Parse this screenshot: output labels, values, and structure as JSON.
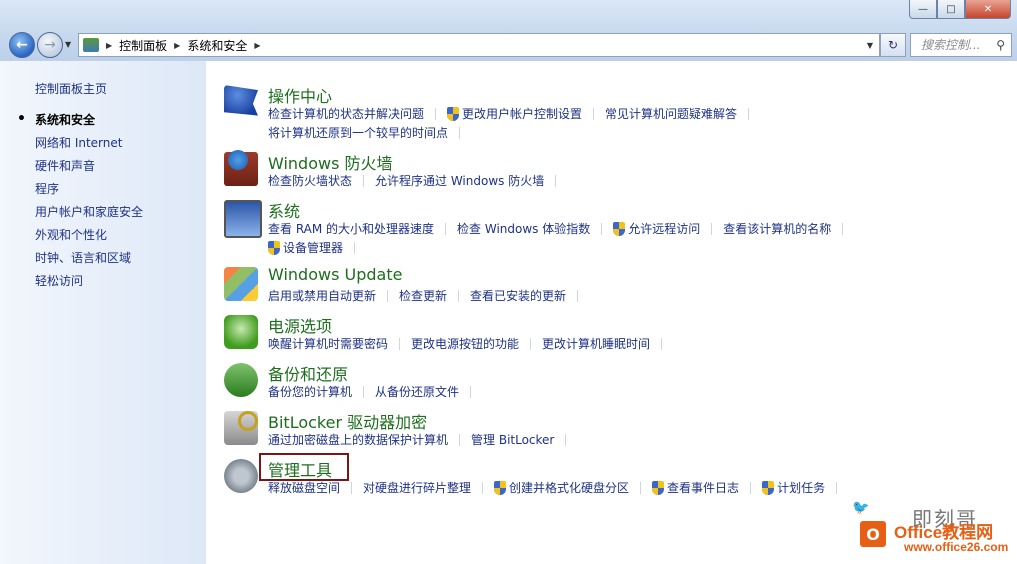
{
  "window": {
    "minimize_glyph": "—",
    "maximize_glyph": "□",
    "close_glyph": "✕"
  },
  "nav": {
    "back_glyph": "←",
    "forward_glyph": "→"
  },
  "address": {
    "crumbs": [
      "控制面板",
      "系统和安全"
    ]
  },
  "search": {
    "placeholder": "搜索控制..."
  },
  "sidebar": {
    "home": "控制面板主页",
    "items": [
      {
        "label": "系统和安全",
        "current": true
      },
      {
        "label": "网络和 Internet"
      },
      {
        "label": "硬件和声音"
      },
      {
        "label": "程序"
      },
      {
        "label": "用户帐户和家庭安全"
      },
      {
        "label": "外观和个性化"
      },
      {
        "label": "时钟、语言和区域"
      },
      {
        "label": "轻松访问"
      }
    ]
  },
  "categories": [
    {
      "title": "操作中心",
      "icon": "action-center-flag-icon",
      "rows": [
        [
          {
            "label": "检查计算机的状态并解决问题"
          },
          {
            "label": "更改用户帐户控制设置",
            "shield": true
          },
          {
            "label": "常见计算机问题疑难解答"
          }
        ],
        [
          {
            "label": "将计算机还原到一个较早的时间点"
          }
        ]
      ]
    },
    {
      "title": "Windows 防火墙",
      "icon": "firewall-icon",
      "rows": [
        [
          {
            "label": "检查防火墙状态"
          },
          {
            "label": "允许程序通过 Windows 防火墙"
          }
        ]
      ]
    },
    {
      "title": "系统",
      "icon": "system-computer-icon",
      "rows": [
        [
          {
            "label": "查看 RAM 的大小和处理器速度"
          },
          {
            "label": "检查 Windows 体验指数"
          },
          {
            "label": "允许远程访问",
            "shield": true
          },
          {
            "label": "查看该计算机的名称"
          }
        ],
        [
          {
            "label": "设备管理器",
            "shield": true
          }
        ]
      ]
    },
    {
      "title": "Windows Update",
      "icon": "windows-update-icon",
      "rows": [
        [
          {
            "label": "启用或禁用自动更新"
          },
          {
            "label": "检查更新"
          },
          {
            "label": "查看已安装的更新"
          }
        ]
      ]
    },
    {
      "title": "电源选项",
      "icon": "power-options-icon",
      "rows": [
        [
          {
            "label": "唤醒计算机时需要密码"
          },
          {
            "label": "更改电源按钮的功能"
          },
          {
            "label": "更改计算机睡眠时间"
          }
        ]
      ]
    },
    {
      "title": "备份和还原",
      "icon": "backup-restore-icon",
      "rows": [
        [
          {
            "label": "备份您的计算机"
          },
          {
            "label": "从备份还原文件"
          }
        ]
      ]
    },
    {
      "title": "BitLocker 驱动器加密",
      "icon": "bitlocker-icon",
      "rows": [
        [
          {
            "label": "通过加密磁盘上的数据保护计算机"
          },
          {
            "label": "管理 BitLocker"
          }
        ]
      ]
    },
    {
      "title": "管理工具",
      "icon": "administrative-tools-icon",
      "rows": [
        [
          {
            "label": "释放磁盘空间"
          },
          {
            "label": "对硬盘进行碎片整理"
          },
          {
            "label": "创建并格式化硬盘分区",
            "shield": true
          },
          {
            "label": "查看事件日志",
            "shield": true
          },
          {
            "label": "计划任务",
            "shield": true
          }
        ]
      ]
    }
  ],
  "watermark": {
    "text": "即刻哥",
    "logo_letter": "O",
    "brand": "Office教程网",
    "url": "www.office26.com"
  }
}
